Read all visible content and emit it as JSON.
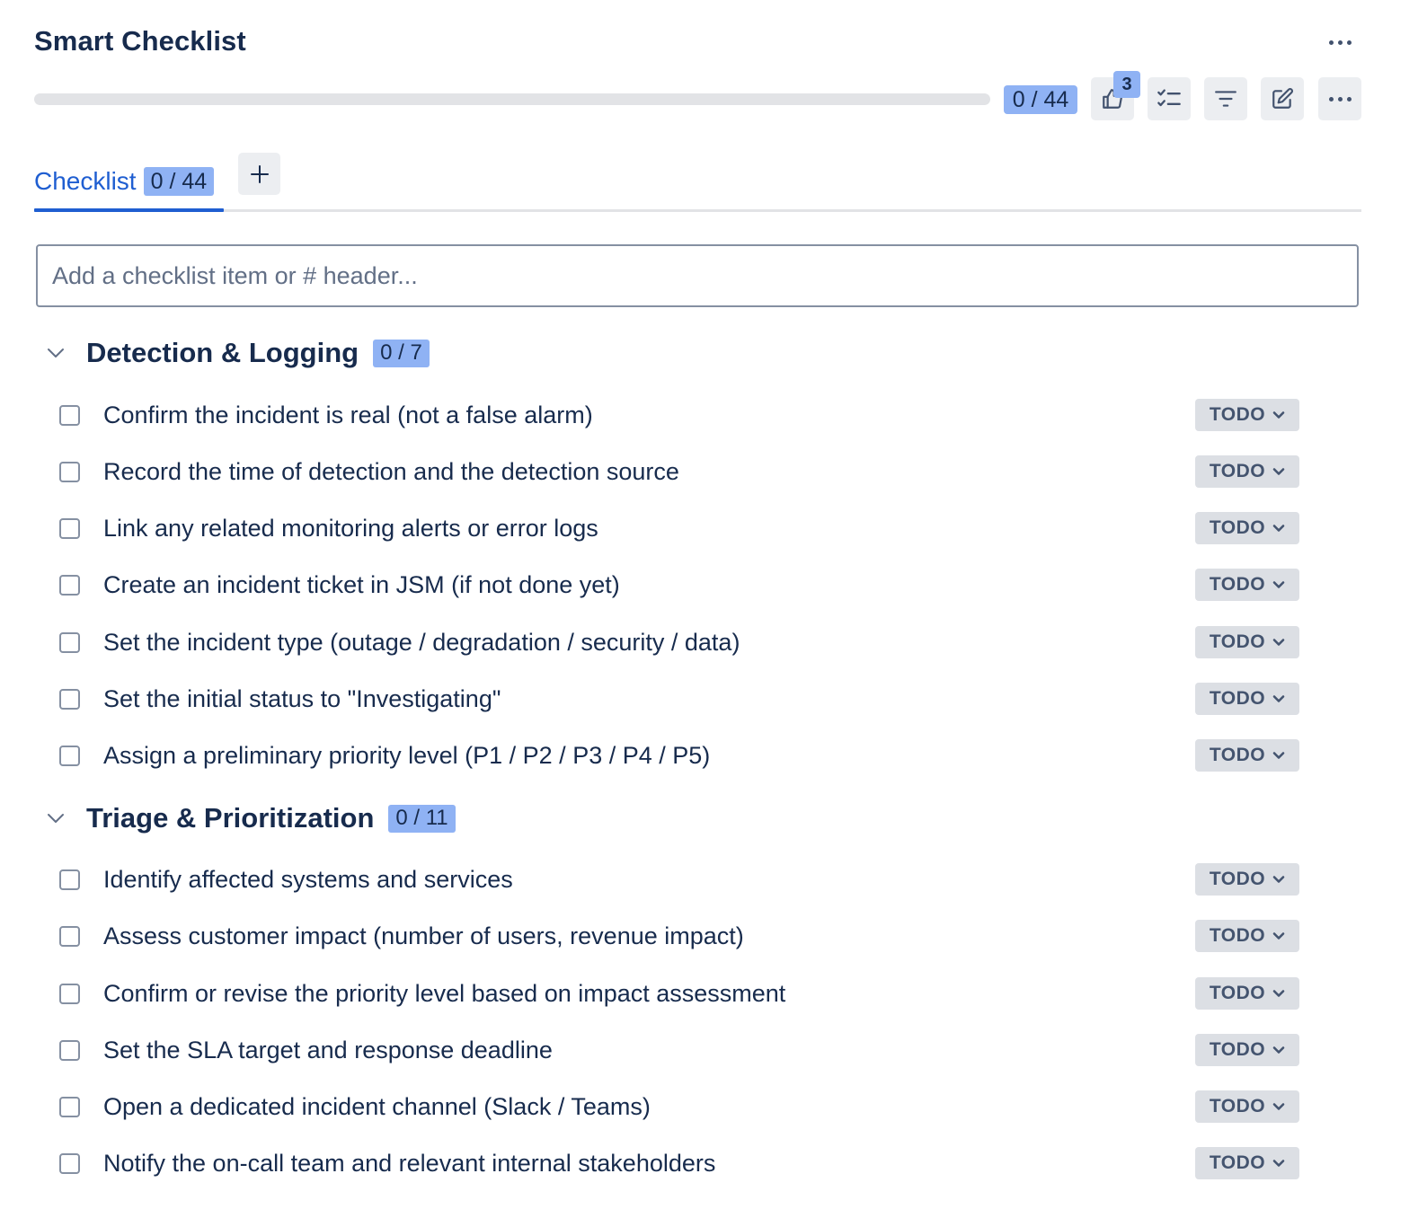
{
  "header": {
    "title": "Smart Checklist",
    "more_icon": "more-horizontal-icon"
  },
  "progress": {
    "completed": 0,
    "total": 44,
    "fraction": 0,
    "label": "0 / 44"
  },
  "toolbar": {
    "notification_count": "3",
    "buttons": [
      {
        "name": "thumbs-up-icon"
      },
      {
        "name": "checklist-icon"
      },
      {
        "name": "filter-icon"
      },
      {
        "name": "edit-icon"
      },
      {
        "name": "more-horizontal-icon"
      }
    ]
  },
  "tabs": [
    {
      "label": "Checklist",
      "count": "0 / 44",
      "active": true
    }
  ],
  "add_tab_icon": "plus-icon",
  "input": {
    "placeholder": "Add a checklist item or # header...",
    "value": ""
  },
  "colors": {
    "accent": "#1f5ed1",
    "badge": "#8fb2f4",
    "status_bg": "#dcdfe4"
  },
  "sections": [
    {
      "title": "Detection & Logging",
      "count": "0 / 7",
      "items": [
        {
          "text": "Confirm the incident is real (not a false alarm)",
          "status": "TODO",
          "checked": false
        },
        {
          "text": "Record the time of detection and the detection source",
          "status": "TODO",
          "checked": false
        },
        {
          "text": "Link any related monitoring alerts or error logs",
          "status": "TODO",
          "checked": false
        },
        {
          "text": "Create an incident ticket in JSM (if not done yet)",
          "status": "TODO",
          "checked": false
        },
        {
          "text": "Set the incident type (outage / degradation / security / data)",
          "status": "TODO",
          "checked": false
        },
        {
          "text": "Set the initial status to \"Investigating\"",
          "status": "TODO",
          "checked": false
        },
        {
          "text": "Assign a preliminary priority level (P1 / P2 / P3 / P4 / P5)",
          "status": "TODO",
          "checked": false
        }
      ]
    },
    {
      "title": "Triage & Prioritization",
      "count": "0 / 11",
      "items": [
        {
          "text": "Identify affected systems and services",
          "status": "TODO",
          "checked": false
        },
        {
          "text": "Assess customer impact (number of users, revenue impact)",
          "status": "TODO",
          "checked": false
        },
        {
          "text": "Confirm or revise the priority level based on impact assessment",
          "status": "TODO",
          "checked": false
        },
        {
          "text": "Set the SLA target and response deadline",
          "status": "TODO",
          "checked": false
        },
        {
          "text": "Open a dedicated incident channel (Slack / Teams)",
          "status": "TODO",
          "checked": false
        },
        {
          "text": "Notify the on-call team and relevant internal stakeholders",
          "status": "TODO",
          "checked": false
        }
      ]
    }
  ]
}
